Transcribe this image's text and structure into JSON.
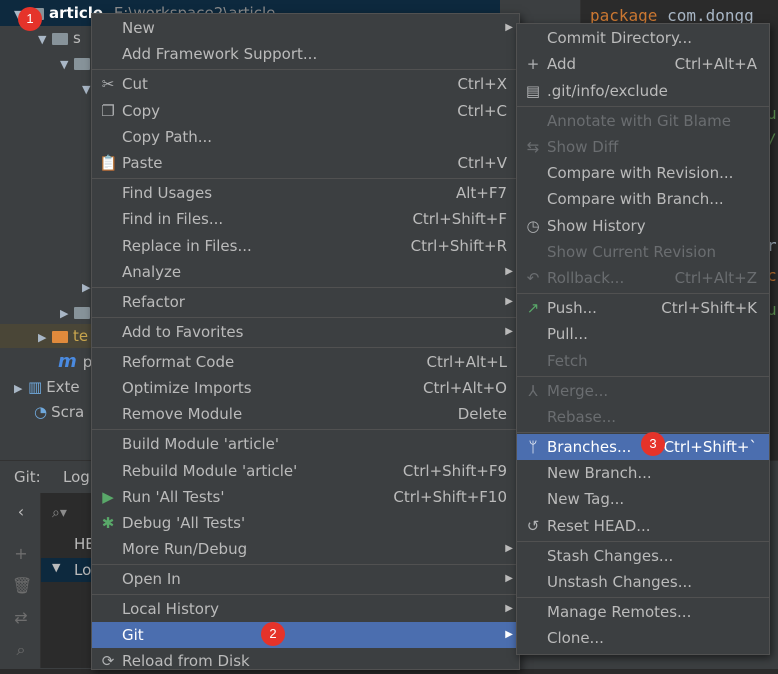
{
  "project": {
    "root_name": "article",
    "root_path": "E:\\workspace2\\article",
    "row_s": "s",
    "row_p": "p",
    "row_te": "te",
    "external_libs": "Exte",
    "scratches": "Scra"
  },
  "editor": {
    "line1_kw": "package",
    "line1_rest": " com.dongg",
    "frag1": "u",
    "frag2": "/",
    "frag3": "r",
    "frag4": "c",
    "frag5": "u"
  },
  "git_pane": {
    "label": "Git:",
    "tab_log": "Log",
    "row_head": "HE",
    "row_local": "Lo"
  },
  "context_menu": {
    "items": [
      {
        "label": "New",
        "submenu": true
      },
      {
        "label": "Add Framework Support..."
      },
      {
        "label": "Cut",
        "shortcut": "Ctrl+X",
        "icon": "scissors-icon"
      },
      {
        "label": "Copy",
        "shortcut": "Ctrl+C",
        "icon": "copy-icon"
      },
      {
        "label": "Copy Path..."
      },
      {
        "label": "Paste",
        "shortcut": "Ctrl+V",
        "icon": "clipboard-icon"
      },
      {
        "label": "Find Usages",
        "shortcut": "Alt+F7"
      },
      {
        "label": "Find in Files...",
        "shortcut": "Ctrl+Shift+F"
      },
      {
        "label": "Replace in Files...",
        "shortcut": "Ctrl+Shift+R"
      },
      {
        "label": "Analyze",
        "submenu": true
      },
      {
        "label": "Refactor",
        "submenu": true
      },
      {
        "label": "Add to Favorites",
        "submenu": true
      },
      {
        "label": "Reformat Code",
        "shortcut": "Ctrl+Alt+L"
      },
      {
        "label": "Optimize Imports",
        "shortcut": "Ctrl+Alt+O"
      },
      {
        "label": "Remove Module",
        "shortcut": "Delete"
      },
      {
        "label": "Build Module 'article'"
      },
      {
        "label": "Rebuild Module 'article'",
        "shortcut": "Ctrl+Shift+F9"
      },
      {
        "label": "Run 'All Tests'",
        "shortcut": "Ctrl+Shift+F10",
        "icon": "run-icon"
      },
      {
        "label": "Debug 'All Tests'",
        "icon": "debug-icon"
      },
      {
        "label": "More Run/Debug",
        "submenu": true
      },
      {
        "label": "Open In",
        "submenu": true
      },
      {
        "label": "Local History",
        "submenu": true
      },
      {
        "label": "Git",
        "submenu": true,
        "highlighted": true
      },
      {
        "label": "Reload from Disk",
        "icon": "reload-icon"
      }
    ]
  },
  "git_menu": {
    "items": [
      {
        "label": "Commit Directory..."
      },
      {
        "label": "Add",
        "shortcut": "Ctrl+Alt+A",
        "icon": "plus-icon"
      },
      {
        "label": ".git/info/exclude",
        "icon": "git-file-icon"
      },
      {
        "label": "Annotate with Git Blame",
        "disabled": true
      },
      {
        "label": "Show Diff",
        "disabled": true,
        "icon": "diff-icon"
      },
      {
        "label": "Compare with Revision..."
      },
      {
        "label": "Compare with Branch..."
      },
      {
        "label": "Show History",
        "icon": "clock-icon"
      },
      {
        "label": "Show Current Revision",
        "disabled": true
      },
      {
        "label": "Rollback...",
        "shortcut": "Ctrl+Alt+Z",
        "disabled": true,
        "icon": "rollback-icon"
      },
      {
        "label": "Push...",
        "shortcut": "Ctrl+Shift+K",
        "icon": "push-arrow-icon"
      },
      {
        "label": "Pull..."
      },
      {
        "label": "Fetch",
        "disabled": true
      },
      {
        "label": "Merge...",
        "disabled": true,
        "icon": "merge-icon"
      },
      {
        "label": "Rebase...",
        "disabled": true
      },
      {
        "label": "Branches...",
        "shortcut": "Ctrl+Shift+`",
        "highlighted": true,
        "icon": "branch-icon"
      },
      {
        "label": "New Branch..."
      },
      {
        "label": "New Tag..."
      },
      {
        "label": "Reset HEAD...",
        "icon": "reset-icon"
      },
      {
        "label": "Stash Changes..."
      },
      {
        "label": "Unstash Changes..."
      },
      {
        "label": "Manage Remotes..."
      },
      {
        "label": "Clone..."
      }
    ]
  },
  "annotations": {
    "badge1": "1",
    "badge2": "2",
    "badge3": "3"
  },
  "colors": {
    "highlight": "#4b6eaf",
    "badge": "#e5332a",
    "menu_bg": "#3c3f41"
  }
}
